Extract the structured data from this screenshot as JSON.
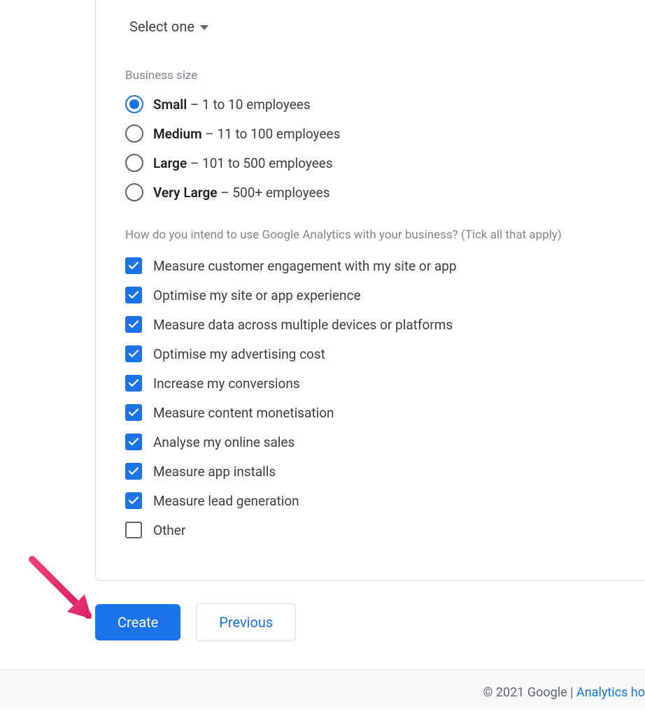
{
  "select": {
    "label": "Select one"
  },
  "businessSize": {
    "label": "Business size",
    "options": [
      {
        "bold": "Small",
        "light": " – 1 to 10 employees",
        "selected": true
      },
      {
        "bold": "Medium",
        "light": " – 11 to 100 employees",
        "selected": false
      },
      {
        "bold": "Large",
        "light": " – 101 to 500 employees",
        "selected": false
      },
      {
        "bold": "Very Large",
        "light": " – 500+ employees",
        "selected": false
      }
    ]
  },
  "usage": {
    "question": "How do you intend to use Google Analytics with your business? (Tick all that apply)",
    "options": [
      {
        "label": "Measure customer engagement with my site or app",
        "checked": true
      },
      {
        "label": "Optimise my site or app experience",
        "checked": true
      },
      {
        "label": "Measure data across multiple devices or platforms",
        "checked": true
      },
      {
        "label": "Optimise my advertising cost",
        "checked": true
      },
      {
        "label": "Increase my conversions",
        "checked": true
      },
      {
        "label": "Measure content monetisation",
        "checked": true
      },
      {
        "label": "Analyse my online sales",
        "checked": true
      },
      {
        "label": "Measure app installs",
        "checked": true
      },
      {
        "label": "Measure lead generation",
        "checked": true
      },
      {
        "label": "Other",
        "checked": false
      }
    ]
  },
  "buttons": {
    "create": "Create",
    "previous": "Previous"
  },
  "footer": {
    "copyright": "© 2021 Google",
    "sep": " | ",
    "link": "Analytics ho"
  }
}
